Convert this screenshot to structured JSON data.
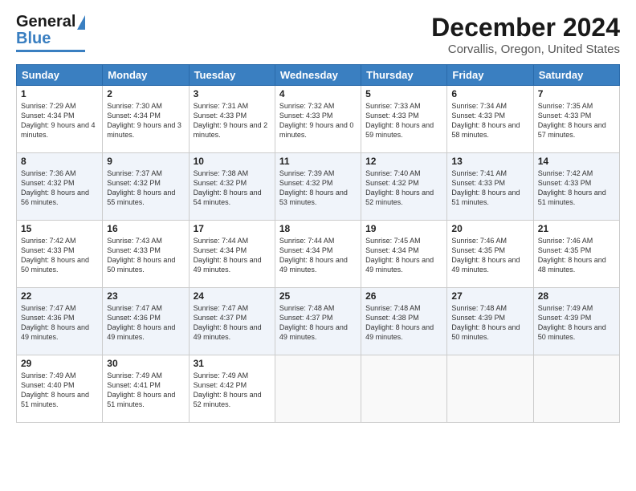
{
  "header": {
    "logo_line1": "General",
    "logo_line2": "Blue",
    "title": "December 2024",
    "subtitle": "Corvallis, Oregon, United States"
  },
  "days_of_week": [
    "Sunday",
    "Monday",
    "Tuesday",
    "Wednesday",
    "Thursday",
    "Friday",
    "Saturday"
  ],
  "weeks": [
    [
      {
        "day": "1",
        "sunrise": "7:29 AM",
        "sunset": "4:34 PM",
        "daylight": "9 hours and 4 minutes."
      },
      {
        "day": "2",
        "sunrise": "7:30 AM",
        "sunset": "4:34 PM",
        "daylight": "9 hours and 3 minutes."
      },
      {
        "day": "3",
        "sunrise": "7:31 AM",
        "sunset": "4:33 PM",
        "daylight": "9 hours and 2 minutes."
      },
      {
        "day": "4",
        "sunrise": "7:32 AM",
        "sunset": "4:33 PM",
        "daylight": "9 hours and 0 minutes."
      },
      {
        "day": "5",
        "sunrise": "7:33 AM",
        "sunset": "4:33 PM",
        "daylight": "8 hours and 59 minutes."
      },
      {
        "day": "6",
        "sunrise": "7:34 AM",
        "sunset": "4:33 PM",
        "daylight": "8 hours and 58 minutes."
      },
      {
        "day": "7",
        "sunrise": "7:35 AM",
        "sunset": "4:33 PM",
        "daylight": "8 hours and 57 minutes."
      }
    ],
    [
      {
        "day": "8",
        "sunrise": "7:36 AM",
        "sunset": "4:32 PM",
        "daylight": "8 hours and 56 minutes."
      },
      {
        "day": "9",
        "sunrise": "7:37 AM",
        "sunset": "4:32 PM",
        "daylight": "8 hours and 55 minutes."
      },
      {
        "day": "10",
        "sunrise": "7:38 AM",
        "sunset": "4:32 PM",
        "daylight": "8 hours and 54 minutes."
      },
      {
        "day": "11",
        "sunrise": "7:39 AM",
        "sunset": "4:32 PM",
        "daylight": "8 hours and 53 minutes."
      },
      {
        "day": "12",
        "sunrise": "7:40 AM",
        "sunset": "4:32 PM",
        "daylight": "8 hours and 52 minutes."
      },
      {
        "day": "13",
        "sunrise": "7:41 AM",
        "sunset": "4:33 PM",
        "daylight": "8 hours and 51 minutes."
      },
      {
        "day": "14",
        "sunrise": "7:42 AM",
        "sunset": "4:33 PM",
        "daylight": "8 hours and 51 minutes."
      }
    ],
    [
      {
        "day": "15",
        "sunrise": "7:42 AM",
        "sunset": "4:33 PM",
        "daylight": "8 hours and 50 minutes."
      },
      {
        "day": "16",
        "sunrise": "7:43 AM",
        "sunset": "4:33 PM",
        "daylight": "8 hours and 50 minutes."
      },
      {
        "day": "17",
        "sunrise": "7:44 AM",
        "sunset": "4:34 PM",
        "daylight": "8 hours and 49 minutes."
      },
      {
        "day": "18",
        "sunrise": "7:44 AM",
        "sunset": "4:34 PM",
        "daylight": "8 hours and 49 minutes."
      },
      {
        "day": "19",
        "sunrise": "7:45 AM",
        "sunset": "4:34 PM",
        "daylight": "8 hours and 49 minutes."
      },
      {
        "day": "20",
        "sunrise": "7:46 AM",
        "sunset": "4:35 PM",
        "daylight": "8 hours and 49 minutes."
      },
      {
        "day": "21",
        "sunrise": "7:46 AM",
        "sunset": "4:35 PM",
        "daylight": "8 hours and 48 minutes."
      }
    ],
    [
      {
        "day": "22",
        "sunrise": "7:47 AM",
        "sunset": "4:36 PM",
        "daylight": "8 hours and 49 minutes."
      },
      {
        "day": "23",
        "sunrise": "7:47 AM",
        "sunset": "4:36 PM",
        "daylight": "8 hours and 49 minutes."
      },
      {
        "day": "24",
        "sunrise": "7:47 AM",
        "sunset": "4:37 PM",
        "daylight": "8 hours and 49 minutes."
      },
      {
        "day": "25",
        "sunrise": "7:48 AM",
        "sunset": "4:37 PM",
        "daylight": "8 hours and 49 minutes."
      },
      {
        "day": "26",
        "sunrise": "7:48 AM",
        "sunset": "4:38 PM",
        "daylight": "8 hours and 49 minutes."
      },
      {
        "day": "27",
        "sunrise": "7:48 AM",
        "sunset": "4:39 PM",
        "daylight": "8 hours and 50 minutes."
      },
      {
        "day": "28",
        "sunrise": "7:49 AM",
        "sunset": "4:39 PM",
        "daylight": "8 hours and 50 minutes."
      }
    ],
    [
      {
        "day": "29",
        "sunrise": "7:49 AM",
        "sunset": "4:40 PM",
        "daylight": "8 hours and 51 minutes."
      },
      {
        "day": "30",
        "sunrise": "7:49 AM",
        "sunset": "4:41 PM",
        "daylight": "8 hours and 51 minutes."
      },
      {
        "day": "31",
        "sunrise": "7:49 AM",
        "sunset": "4:42 PM",
        "daylight": "8 hours and 52 minutes."
      },
      null,
      null,
      null,
      null
    ]
  ]
}
